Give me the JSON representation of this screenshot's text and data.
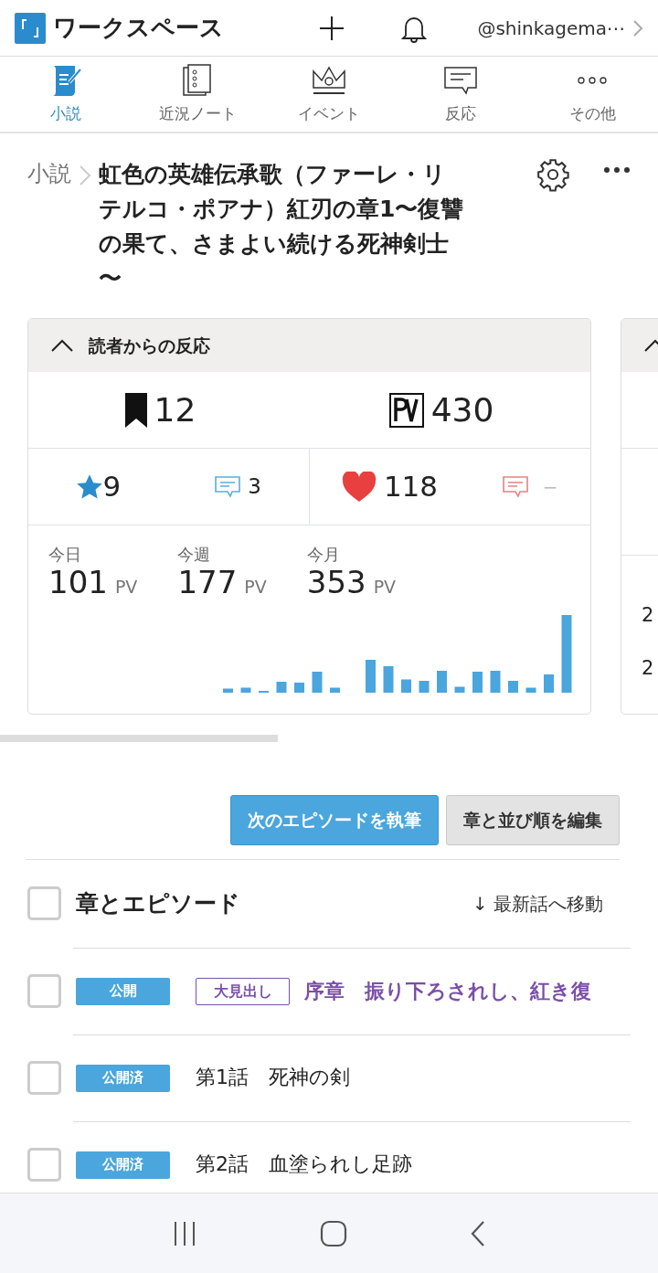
{
  "header": {
    "title": "ワークスペース",
    "account": "@shinkagema⋯"
  },
  "tabs": [
    {
      "label": "小説",
      "selected": true
    },
    {
      "label": "近況ノート",
      "selected": false
    },
    {
      "label": "イベント",
      "selected": false
    },
    {
      "label": "反応",
      "selected": false
    },
    {
      "label": "その他",
      "selected": false
    }
  ],
  "breadcrumb": "小説",
  "work_title": "虹色の英雄伝承歌（ファーレ・リテルコ・ポアナ）紅刃の章1〜復讐の果て、さまよい続ける死神剣士〜",
  "reactions_card": {
    "title": "読者からの反応",
    "expanded": true,
    "followers": "12",
    "pv": "430",
    "star_count": "9",
    "reviews": "3",
    "hearts": "118",
    "comments": "−",
    "periods": [
      {
        "label": "今日",
        "value": "101",
        "unit": "PV"
      },
      {
        "label": "今週",
        "value": "177",
        "unit": "PV"
      },
      {
        "label": "今月",
        "value": "353",
        "unit": "PV"
      }
    ]
  },
  "side_card": {
    "expanded": true,
    "texts": [
      "2",
      "2"
    ]
  },
  "buttons": [
    {
      "label": "次のエピソードを執筆",
      "kind": "primary"
    },
    {
      "label": "章と並び順を編集",
      "kind": "secondary"
    }
  ],
  "episode_list": {
    "title": "章とエピソード",
    "checked": false,
    "jump_link": "↓ 最新話へ移動"
  },
  "episodes": [
    {
      "kind": "heading",
      "status": "公開",
      "label": "大見出し",
      "title": "序章　振り下ろされし、紅き復",
      "checked": false
    },
    {
      "kind": "episode",
      "status": "公開済",
      "title": "第1話　死神の剣",
      "checked": false
    },
    {
      "kind": "episode",
      "status": "公開済",
      "title": "第2話　血塗られし足跡",
      "checked": false
    }
  ]
}
